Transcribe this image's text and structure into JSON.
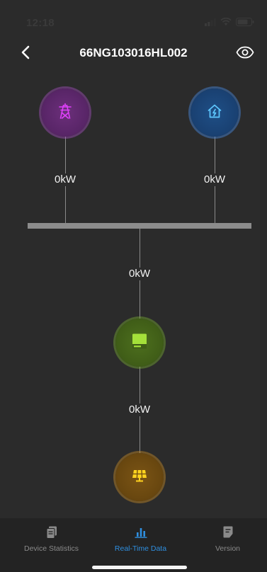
{
  "status_bar": {
    "time": "12:18",
    "icons": [
      "signal-icon",
      "wifi-icon",
      "battery-icon"
    ]
  },
  "header": {
    "title": "66NG103016HL002",
    "back_icon": "chevron-left-icon",
    "eye_icon": "eye-icon"
  },
  "flow": {
    "grid": {
      "icon": "power-tower-icon",
      "power": "0kW",
      "color": "#e040fb"
    },
    "home": {
      "icon": "home-bolt-icon",
      "power": "0kW",
      "color": "#5ec8ff"
    },
    "inverter": {
      "icon": "inverter-icon",
      "power": "0kW",
      "color": "#a4e03a"
    },
    "solar": {
      "icon": "solar-panel-icon",
      "power": "0kW",
      "color": "#ffd21f"
    }
  },
  "tabs": [
    {
      "label": "Device Statistics",
      "icon": "document-icon",
      "active": false
    },
    {
      "label": "Real-Time Data",
      "icon": "bar-chart-icon",
      "active": true
    },
    {
      "label": "Version",
      "icon": "note-icon",
      "active": false
    }
  ],
  "colors": {
    "background": "#2b2b2b",
    "accent": "#2f8fe0",
    "tab_inactive": "#8a8a8a"
  }
}
